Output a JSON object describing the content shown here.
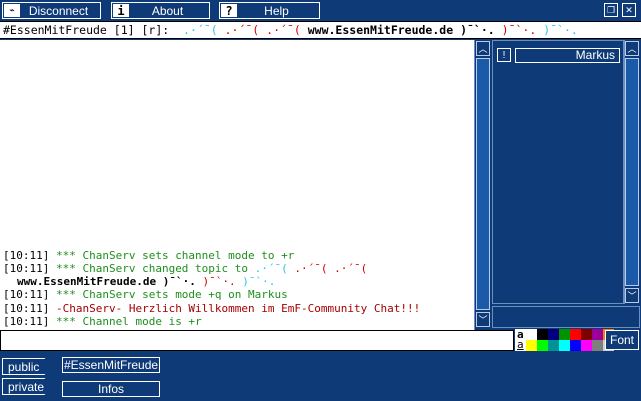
{
  "toolbar": {
    "disconnect_label": "Disconnect",
    "about_label": "About",
    "about_icon_glyph": "i",
    "help_label": "Help",
    "help_icon_glyph": "?"
  },
  "topic": {
    "channel": "#EssenMitFreude",
    "modes": " [1] [r]: ",
    "deco1": ".·´¯(",
    "deco2": ".·´¯(",
    "deco3": ".·´¯(",
    "site": "www.EssenMitFreude.de",
    "deco4": ")¯`·.",
    "deco5": ")¯`·.",
    "deco6": ")¯`·."
  },
  "chat": {
    "lines": [
      {
        "ts": "[10:11]",
        "text": " *** ChanServ sets channel mode to +r"
      },
      {
        "ts": "[10:11]",
        "text": " *** ChanServ changed topic to "
      },
      {
        "ts": "[10:11]",
        "text": " *** ChanServ sets mode +q on Markus"
      },
      {
        "ts": "[10:11]",
        "text": " -ChanServ- Herzlich Willkommen im EmF-Community Chat!!!"
      },
      {
        "ts": "[10:11]",
        "text": " *** Channel mode is +r"
      }
    ],
    "topic_deco_a": ".·´¯(",
    "topic_deco_b": ".·´¯(",
    "topic_deco_c": ".·´¯(",
    "topic_site": "www.EssenMitFreude.de",
    "topic_deco_d": ")¯`·.",
    "topic_deco_e": ")¯`·.",
    "topic_deco_f": ")¯`·."
  },
  "users": {
    "list": [
      {
        "badge": "!",
        "name": "Markus"
      }
    ]
  },
  "palette": {
    "text_sample": "a",
    "underline_sample": "a",
    "colors_row1": [
      "#ffffff",
      "#000000",
      "#00007f",
      "#009300",
      "#ff0000",
      "#7f0000",
      "#9c009c",
      "#fc7f00"
    ],
    "colors_row2": [
      "#ffff00",
      "#00fc00",
      "#009393",
      "#00ffff",
      "#0000fc",
      "#ff00ff",
      "#7f7f7f",
      "#d2d2d2"
    ]
  },
  "font_button": "Font",
  "tabs": {
    "public_label": "public",
    "private_label": "private",
    "public_channel": "#EssenMitFreude",
    "private_infos": "Infos"
  },
  "colors": {
    "background": "#0f3a78",
    "panel_border": "#6b8fc0",
    "chat_green": "#1e8f1e",
    "chat_darkred": "#a40000",
    "topic_cyan": "#29c4e8",
    "topic_red": "#d00000"
  }
}
